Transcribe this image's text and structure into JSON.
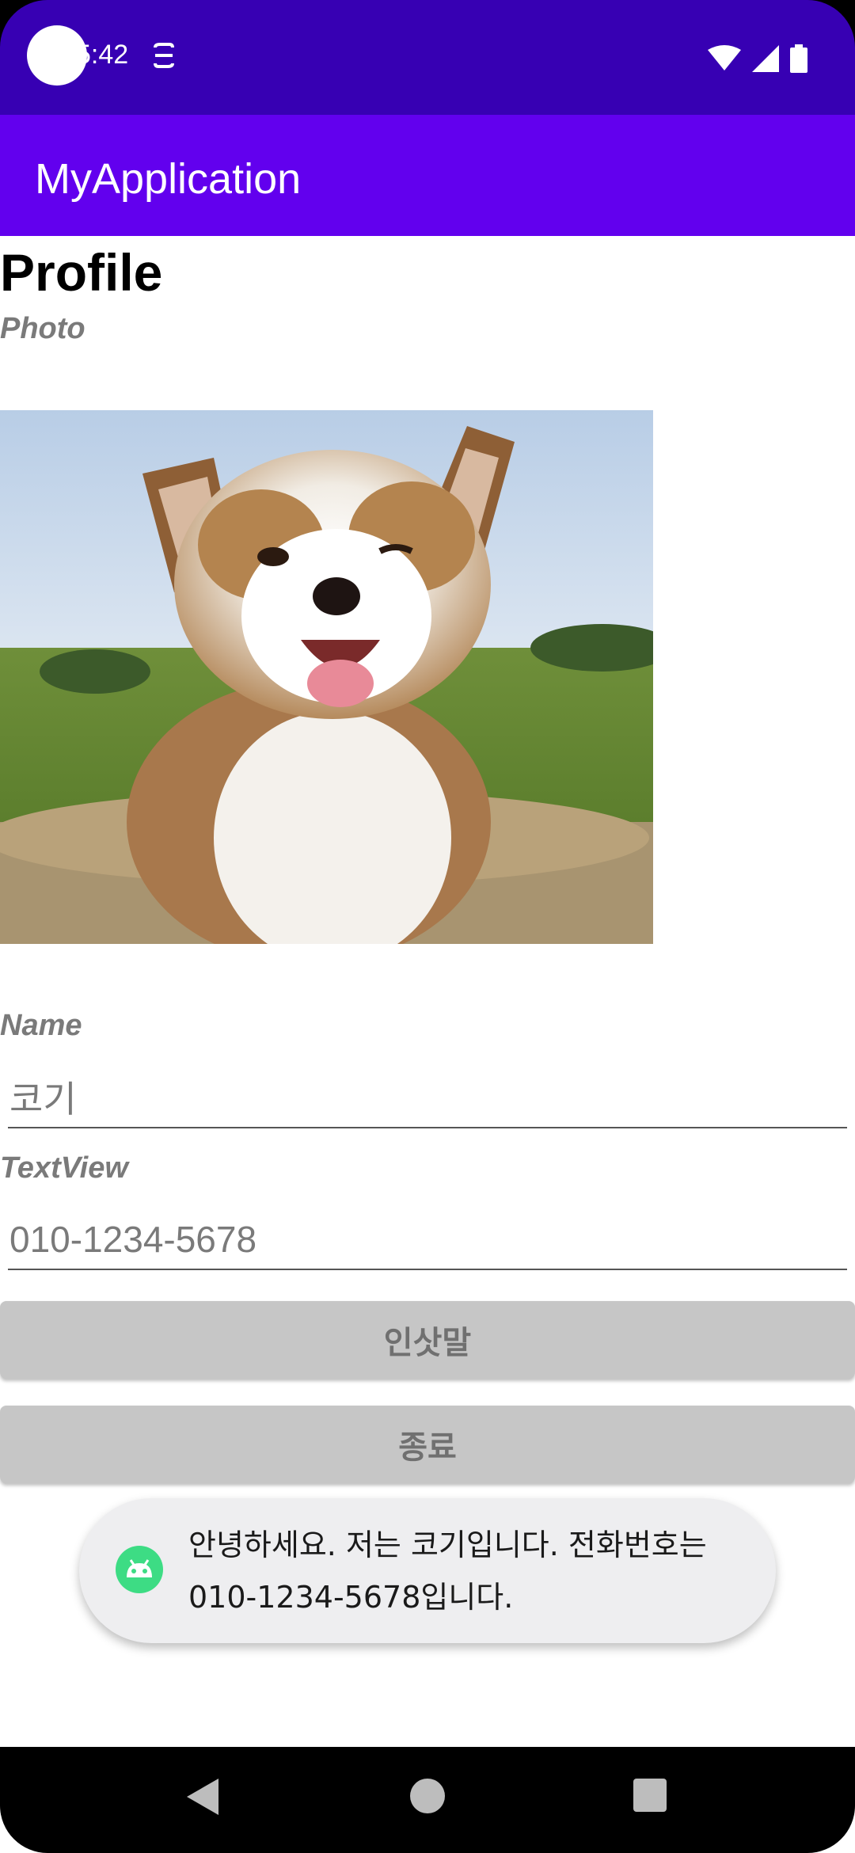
{
  "status": {
    "time": "5:42"
  },
  "app": {
    "title": "MyApplication"
  },
  "profile": {
    "title": "Profile",
    "photo_label": "Photo",
    "name_label": "Name",
    "name_value": "코기",
    "phone_label": "TextView",
    "phone_value": "010-1234-5678"
  },
  "buttons": {
    "greet": "인삿말",
    "exit": "종료"
  },
  "toast": {
    "message": "안녕하세요. 저는 코기입니다. 전화번호는 010-1234-5678입니다."
  },
  "colors": {
    "status_bar": "#3700b3",
    "app_bar": "#6200ee",
    "button_bg": "#c6c6c6"
  },
  "icons": [
    "notification-icon",
    "wifi-icon",
    "signal-icon",
    "battery-icon",
    "android-icon",
    "back-icon",
    "home-icon",
    "recents-icon"
  ]
}
